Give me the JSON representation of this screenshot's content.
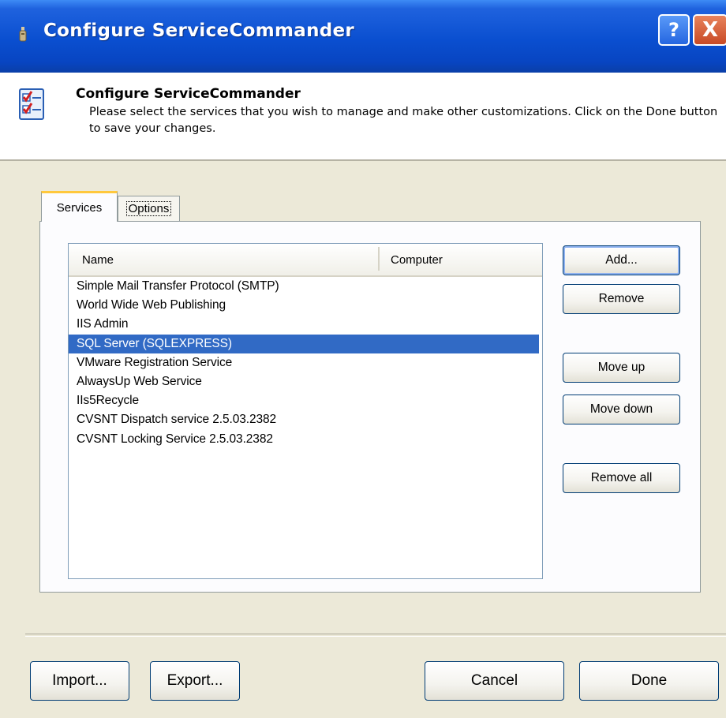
{
  "window": {
    "title": "Configure ServiceCommander",
    "help_label": "?",
    "close_label": "X"
  },
  "header": {
    "title": "Configure ServiceCommander",
    "description": "Please select the services that you wish to manage and make other customizations. Click on the Done button to save your changes."
  },
  "tabs": [
    {
      "label": "Services",
      "selected": true
    },
    {
      "label": "Options",
      "selected": false
    }
  ],
  "services_list": {
    "columns": [
      "Name",
      "Computer"
    ],
    "rows": [
      {
        "name": "Simple Mail Transfer Protocol (SMTP)",
        "computer": ""
      },
      {
        "name": "World Wide Web Publishing",
        "computer": ""
      },
      {
        "name": "IIS Admin",
        "computer": ""
      },
      {
        "name": "SQL Server (SQLEXPRESS)",
        "computer": "",
        "selected": true
      },
      {
        "name": "VMware Registration Service",
        "computer": ""
      },
      {
        "name": "AlwaysUp Web Service",
        "computer": ""
      },
      {
        "name": "IIs5Recycle",
        "computer": ""
      },
      {
        "name": "CVSNT Dispatch service 2.5.03.2382",
        "computer": ""
      },
      {
        "name": "CVSNT Locking Service 2.5.03.2382",
        "computer": ""
      }
    ]
  },
  "side_buttons": {
    "add": "Add...",
    "remove": "Remove",
    "move_up": "Move up",
    "move_down": "Move down",
    "remove_all": "Remove all"
  },
  "bottom_buttons": {
    "import": "Import...",
    "export": "Export...",
    "cancel": "Cancel",
    "done": "Done"
  },
  "colors": {
    "titlebar": "#0a4fd0",
    "selection": "#316ac5",
    "dialog_bg": "#ece9d8",
    "tab_highlight": "#ffc83c"
  },
  "icons": {
    "app": "service-gear-icon",
    "header": "checklist-icon",
    "help": "help-icon",
    "close": "close-icon"
  }
}
